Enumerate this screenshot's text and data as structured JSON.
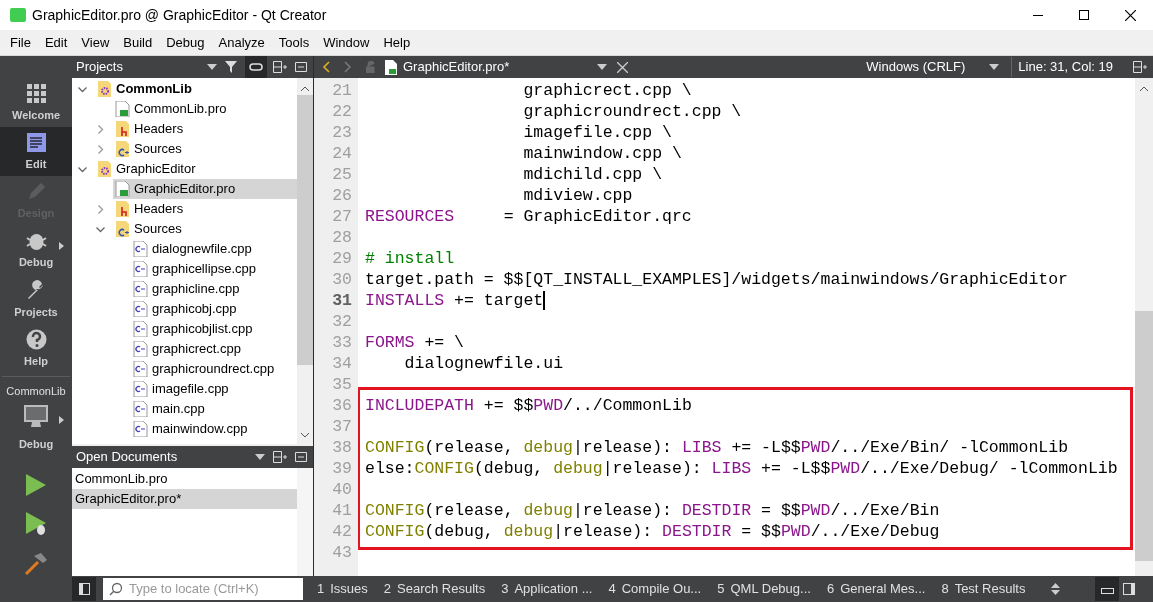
{
  "window": {
    "title": "GraphicEditor.pro @ GraphicEditor - Qt Creator"
  },
  "menu": [
    "File",
    "Edit",
    "View",
    "Build",
    "Debug",
    "Analyze",
    "Tools",
    "Window",
    "Help"
  ],
  "modes": [
    {
      "label": "Welcome",
      "kind": "welcome",
      "selected": false,
      "disabled": false
    },
    {
      "label": "Edit",
      "kind": "edit",
      "selected": true,
      "disabled": false
    },
    {
      "label": "Design",
      "kind": "design",
      "selected": false,
      "disabled": true
    },
    {
      "label": "Debug",
      "kind": "debug",
      "selected": false,
      "disabled": false
    },
    {
      "label": "Projects",
      "kind": "projects",
      "selected": false,
      "disabled": false
    },
    {
      "label": "Help",
      "kind": "help",
      "selected": false,
      "disabled": false
    }
  ],
  "kit": {
    "project": "CommonLib",
    "build": "Debug"
  },
  "projects": {
    "title": "Projects",
    "tree": [
      {
        "label": "CommonLib",
        "kind": "project",
        "active": true,
        "expanded": true,
        "selected": false,
        "children": [
          {
            "label": "CommonLib.pro",
            "kind": "pro",
            "selected": false
          },
          {
            "label": "Headers",
            "kind": "headers",
            "expanded": false,
            "selected": false
          },
          {
            "label": "Sources",
            "kind": "sources",
            "expanded": false,
            "selected": false
          }
        ]
      },
      {
        "label": "GraphicEditor",
        "kind": "project",
        "active": false,
        "expanded": true,
        "selected": false,
        "children": [
          {
            "label": "GraphicEditor.pro",
            "kind": "pro",
            "selected": true
          },
          {
            "label": "Headers",
            "kind": "headers",
            "expanded": false,
            "selected": false
          },
          {
            "label": "Sources",
            "kind": "sources",
            "expanded": true,
            "selected": false,
            "children": [
              {
                "label": "dialognewfile.cpp",
                "kind": "cpp",
                "selected": false
              },
              {
                "label": "graphicellipse.cpp",
                "kind": "cpp",
                "selected": false
              },
              {
                "label": "graphicline.cpp",
                "kind": "cpp",
                "selected": false
              },
              {
                "label": "graphicobj.cpp",
                "kind": "cpp",
                "selected": false
              },
              {
                "label": "graphicobjlist.cpp",
                "kind": "cpp",
                "selected": false
              },
              {
                "label": "graphicrect.cpp",
                "kind": "cpp",
                "selected": false
              },
              {
                "label": "graphicroundrect.cpp",
                "kind": "cpp",
                "selected": false
              },
              {
                "label": "imagefile.cpp",
                "kind": "cpp",
                "selected": false
              },
              {
                "label": "main.cpp",
                "kind": "cpp",
                "selected": false
              },
              {
                "label": "mainwindow.cpp",
                "kind": "cpp",
                "selected": false
              }
            ]
          }
        ]
      }
    ]
  },
  "open_documents": {
    "title": "Open Documents",
    "items": [
      {
        "label": "CommonLib.pro",
        "selected": false
      },
      {
        "label": "GraphicEditor.pro*",
        "selected": true
      }
    ]
  },
  "editor": {
    "file": "GraphicEditor.pro*",
    "line_ending": "Windows (CRLF)",
    "position": "Line: 31, Col: 19",
    "blocks": [
      {
        "boxed": false,
        "lines": [
          {
            "number": "21",
            "current": false,
            "segments": [
              {
                "kind": "plain",
                "text": "                graphicrect.cpp \\"
              }
            ]
          },
          {
            "number": "22",
            "current": false,
            "segments": [
              {
                "kind": "plain",
                "text": "                graphicroundrect.cpp \\"
              }
            ]
          },
          {
            "number": "23",
            "current": false,
            "segments": [
              {
                "kind": "plain",
                "text": "                imagefile.cpp \\"
              }
            ]
          },
          {
            "number": "24",
            "current": false,
            "segments": [
              {
                "kind": "plain",
                "text": "                mainwindow.cpp \\"
              }
            ]
          },
          {
            "number": "25",
            "current": false,
            "segments": [
              {
                "kind": "plain",
                "text": "                mdichild.cpp \\"
              }
            ]
          },
          {
            "number": "26",
            "current": false,
            "segments": [
              {
                "kind": "plain",
                "text": "                mdiview.cpp"
              }
            ]
          },
          {
            "number": "27",
            "current": false,
            "segments": [
              {
                "kind": "keyword",
                "text": "RESOURCES"
              },
              {
                "kind": "plain",
                "text": "     = GraphicEditor.qrc"
              }
            ]
          },
          {
            "number": "28",
            "current": false
          },
          {
            "number": "29",
            "current": false,
            "segments": [
              {
                "kind": "comment",
                "text": "# install"
              }
            ]
          },
          {
            "number": "30",
            "current": false,
            "segments": [
              {
                "kind": "plain",
                "text": "target.path = $$[QT_INSTALL_EXAMPLES]/widgets/mainwindows/GraphicEditor"
              }
            ]
          },
          {
            "number": "31",
            "current": true,
            "segments": [
              {
                "kind": "keyword",
                "text": "INSTALLS"
              },
              {
                "kind": "plain",
                "text": " += target"
              }
            ]
          },
          {
            "number": "32",
            "current": false
          },
          {
            "number": "33",
            "current": false,
            "segments": [
              {
                "kind": "keyword",
                "text": "FORMS"
              },
              {
                "kind": "plain",
                "text": " += \\"
              }
            ]
          },
          {
            "number": "34",
            "current": false,
            "segments": [
              {
                "kind": "plain",
                "text": "    dialognewfile.ui"
              }
            ]
          },
          {
            "number": "35",
            "current": false
          }
        ]
      },
      {
        "boxed": true,
        "lines": [
          {
            "number": "36",
            "current": false,
            "segments": [
              {
                "kind": "keyword",
                "text": "INCLUDEPATH"
              },
              {
                "kind": "plain",
                "text": " += $$"
              },
              {
                "kind": "keyword",
                "text": "PWD"
              },
              {
                "kind": "plain",
                "text": "/../CommonLib"
              }
            ]
          },
          {
            "number": "37",
            "current": false
          },
          {
            "number": "38",
            "current": false,
            "segments": [
              {
                "kind": "function",
                "text": "CONFIG"
              },
              {
                "kind": "plain",
                "text": "(release, "
              },
              {
                "kind": "function",
                "text": "debug"
              },
              {
                "kind": "plain",
                "text": "|release): "
              },
              {
                "kind": "keyword",
                "text": "LIBS"
              },
              {
                "kind": "plain",
                "text": " += -L$$"
              },
              {
                "kind": "keyword",
                "text": "PWD"
              },
              {
                "kind": "plain",
                "text": "/../Exe/Bin/ -lCommonLib"
              }
            ]
          },
          {
            "number": "39",
            "current": false,
            "segments": [
              {
                "kind": "plain",
                "text": "else:"
              },
              {
                "kind": "function",
                "text": "CONFIG"
              },
              {
                "kind": "plain",
                "text": "(debug, "
              },
              {
                "kind": "function",
                "text": "debug"
              },
              {
                "kind": "plain",
                "text": "|release): "
              },
              {
                "kind": "keyword",
                "text": "LIBS"
              },
              {
                "kind": "plain",
                "text": " += -L$$"
              },
              {
                "kind": "keyword",
                "text": "PWD"
              },
              {
                "kind": "plain",
                "text": "/../Exe/Debug/ -lCommonLib"
              }
            ]
          },
          {
            "number": "40",
            "current": false
          },
          {
            "number": "41",
            "current": false,
            "segments": [
              {
                "kind": "function",
                "text": "CONFIG"
              },
              {
                "kind": "plain",
                "text": "(release, "
              },
              {
                "kind": "function",
                "text": "debug"
              },
              {
                "kind": "plain",
                "text": "|release): "
              },
              {
                "kind": "keyword",
                "text": "DESTDIR"
              },
              {
                "kind": "plain",
                "text": " = $$"
              },
              {
                "kind": "keyword",
                "text": "PWD"
              },
              {
                "kind": "plain",
                "text": "/../Exe/Bin"
              }
            ]
          },
          {
            "number": "42",
            "current": false,
            "segments": [
              {
                "kind": "function",
                "text": "CONFIG"
              },
              {
                "kind": "plain",
                "text": "(debug, "
              },
              {
                "kind": "function",
                "text": "debug"
              },
              {
                "kind": "plain",
                "text": "|release): "
              },
              {
                "kind": "keyword",
                "text": "DESTDIR"
              },
              {
                "kind": "plain",
                "text": " = $$"
              },
              {
                "kind": "keyword",
                "text": "PWD"
              },
              {
                "kind": "plain",
                "text": "/../Exe/Debug"
              }
            ]
          }
        ]
      },
      {
        "boxed": false,
        "lines": [
          {
            "number": "43",
            "current": false
          }
        ]
      }
    ]
  },
  "status_bar": {
    "locator_placeholder": "Type to locate (Ctrl+K)",
    "panes": [
      {
        "number": "1",
        "label": "Issues"
      },
      {
        "number": "2",
        "label": "Search Results"
      },
      {
        "number": "3",
        "label": "Application ..."
      },
      {
        "number": "4",
        "label": "Compile Ou..."
      },
      {
        "number": "5",
        "label": "QML Debug..."
      },
      {
        "number": "6",
        "label": "General Mes..."
      },
      {
        "number": "8",
        "label": "Test Results"
      }
    ]
  }
}
